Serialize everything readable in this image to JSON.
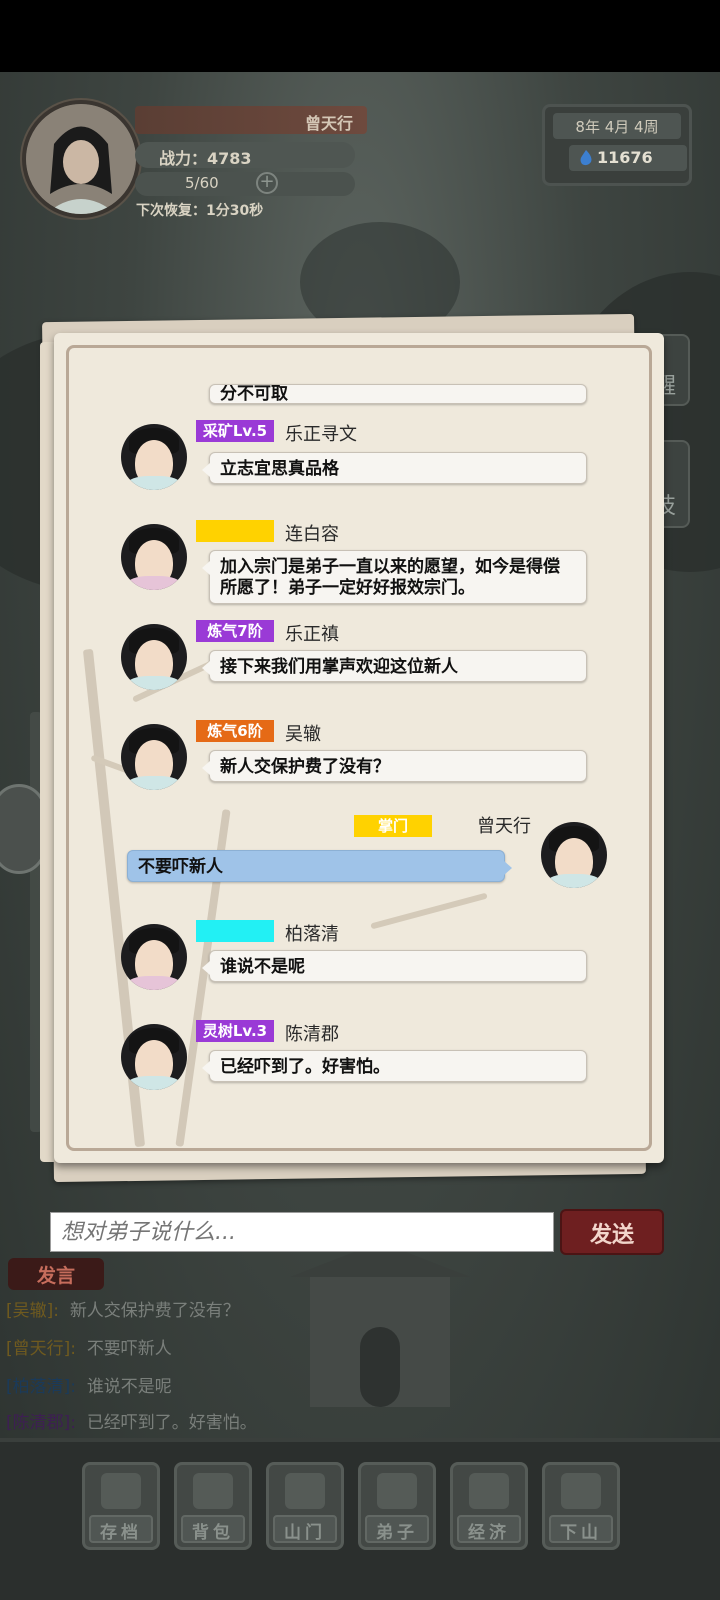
{
  "player": {
    "name": "曾天行",
    "power": "战力：4783",
    "stamina": "5/60",
    "recover": "下次恢复：1分30秒"
  },
  "calendar": {
    "date": "8年  4月  4周",
    "spirit_stones": "11676"
  },
  "side": {
    "right_1": "醒",
    "right_2": "技"
  },
  "dialog": {
    "partial_message": "分不可取",
    "messages": [
      {
        "badge": "采矿Lv.5",
        "badge_color": "#9a3ad6",
        "name": "乐正寻文",
        "text": "立志宜思真品格"
      },
      {
        "badge": "",
        "badge_color": "#ffd200",
        "name": "连白容",
        "text": "加入宗门是弟子一直以来的愿望，如今是得偿所愿了！弟子一定好好报效宗门。"
      },
      {
        "badge": "炼气7阶",
        "badge_color": "#9a3ad6",
        "name": "乐正禛",
        "text": "接下来我们用掌声欢迎这位新人"
      },
      {
        "badge": "炼气6阶",
        "badge_color": "#e56a16",
        "name": "吴辙",
        "text": "新人交保护费了没有？"
      },
      {
        "badge": "掌门",
        "badge_color": "#ffd200",
        "name": "曾天行",
        "text": "不要吓新人"
      },
      {
        "badge": "",
        "badge_color": "#22f0f4",
        "name": "柏落清",
        "text": "谁说不是呢"
      },
      {
        "badge": "灵树Lv.3",
        "badge_color": "#9a3ad6",
        "name": "陈清郡",
        "text": "已经吓到了。好害怕。"
      }
    ]
  },
  "input": {
    "placeholder": "想对弟子说什么...",
    "send_label": "发送"
  },
  "speech_log": {
    "tab_label": "发言",
    "lines": [
      {
        "who": "[吴辙]:",
        "text": "新人交保护费了没有？"
      },
      {
        "who": "[曾天行]:",
        "text": "不要吓新人"
      },
      {
        "who": "[柏落清]:",
        "text": "谁说不是呢"
      },
      {
        "who": "[陈清郡]:",
        "text": "已经吓到了。好害怕。"
      }
    ]
  },
  "nav": {
    "items": [
      {
        "label": "存档",
        "icon": "book-icon"
      },
      {
        "label": "背包",
        "icon": "bag-icon"
      },
      {
        "label": "山门",
        "icon": "gate-icon"
      },
      {
        "label": "弟子",
        "icon": "disciple-icon"
      },
      {
        "label": "经济",
        "icon": "economy-icon"
      },
      {
        "label": "下山",
        "icon": "mountain-icon"
      }
    ]
  },
  "colors": {
    "purple_badge": "#9a3ad6",
    "orange_badge": "#e56a16",
    "yellow_badge": "#ffd200",
    "cyan_badge": "#22f0f4",
    "my_bubble": "#9fc3e8",
    "send_button": "#6e1f20"
  }
}
